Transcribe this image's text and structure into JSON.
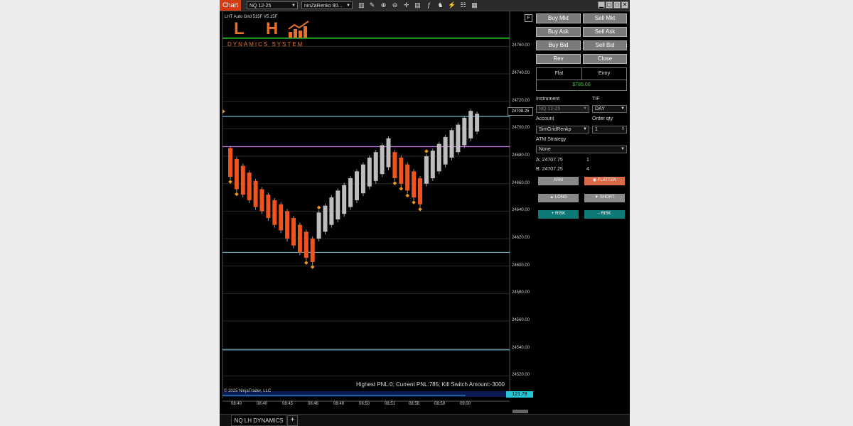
{
  "titlebar": {
    "tab_label": "Chart",
    "instrument_select": "NQ 12-25",
    "bartype_select": "ninZaRenko 80..."
  },
  "chart": {
    "indicator_label": "LHT Auto Grid 515F V5.15F",
    "logo_letters": "L H",
    "logo_subtitle": "DYNAMICS SYSTEM",
    "f_button": "F",
    "pnl_text": "Highest PNL:0; Current PNL:785; Kill Switch Amount:-3000",
    "copyright": "© 2025 NinjaTrader, LLC",
    "volume_value": "121.78",
    "current_price": "24708.25",
    "price_labels": [
      "24760.00",
      "24740.00",
      "24720.00",
      "24700.00",
      "24680.00",
      "24660.00",
      "24640.00",
      "24620.00",
      "24600.00",
      "24580.00",
      "24560.00",
      "24540.00",
      "24520.00"
    ],
    "time_labels": [
      "08:40",
      "08:40",
      "08:45",
      "08:46",
      "08:49",
      "08:50",
      "08:51",
      "08:56",
      "08:59",
      "09:00"
    ],
    "colors": {
      "up_bar": "#bdbdbd",
      "down_bar": "#f0541e",
      "green_line": "#22a822",
      "magenta_line": "#c070e0",
      "teal_line": "#6fb8c8",
      "diamond": "#e8961e"
    }
  },
  "chart_data": {
    "type": "renko",
    "ylim": [
      24513,
      24785
    ],
    "bricks": [
      {
        "dir": "down",
        "open": 24686,
        "close": 24665
      },
      {
        "dir": "down",
        "open": 24678,
        "close": 24656
      },
      {
        "dir": "down",
        "open": 24673,
        "close": 24652
      },
      {
        "dir": "down",
        "open": 24668,
        "close": 24648
      },
      {
        "dir": "down",
        "open": 24662,
        "close": 24643
      },
      {
        "dir": "down",
        "open": 24656,
        "close": 24640
      },
      {
        "dir": "down",
        "open": 24652,
        "close": 24635
      },
      {
        "dir": "down",
        "open": 24648,
        "close": 24630
      },
      {
        "dir": "down",
        "open": 24645,
        "close": 24626
      },
      {
        "dir": "down",
        "open": 24640,
        "close": 24620
      },
      {
        "dir": "down",
        "open": 24635,
        "close": 24615
      },
      {
        "dir": "down",
        "open": 24630,
        "close": 24610
      },
      {
        "dir": "down",
        "open": 24625,
        "close": 24606
      },
      {
        "dir": "down",
        "open": 24620,
        "close": 24603
      },
      {
        "dir": "up",
        "open": 24620,
        "close": 24639
      },
      {
        "dir": "up",
        "open": 24625,
        "close": 24644
      },
      {
        "dir": "up",
        "open": 24630,
        "close": 24650
      },
      {
        "dir": "up",
        "open": 24634,
        "close": 24655
      },
      {
        "dir": "up",
        "open": 24638,
        "close": 24659
      },
      {
        "dir": "up",
        "open": 24643,
        "close": 24664
      },
      {
        "dir": "up",
        "open": 24648,
        "close": 24669
      },
      {
        "dir": "up",
        "open": 24653,
        "close": 24674
      },
      {
        "dir": "up",
        "open": 24658,
        "close": 24679
      },
      {
        "dir": "up",
        "open": 24662,
        "close": 24683
      },
      {
        "dir": "up",
        "open": 24667,
        "close": 24688
      },
      {
        "dir": "up",
        "open": 24672,
        "close": 24693
      },
      {
        "dir": "down",
        "open": 24683,
        "close": 24664
      },
      {
        "dir": "down",
        "open": 24679,
        "close": 24660
      },
      {
        "dir": "down",
        "open": 24674,
        "close": 24655
      },
      {
        "dir": "down",
        "open": 24669,
        "close": 24650
      },
      {
        "dir": "down",
        "open": 24664,
        "close": 24645
      },
      {
        "dir": "up",
        "open": 24660,
        "close": 24680
      },
      {
        "dir": "up",
        "open": 24664,
        "close": 24684
      },
      {
        "dir": "up",
        "open": 24669,
        "close": 24689
      },
      {
        "dir": "up",
        "open": 24674,
        "close": 24694
      },
      {
        "dir": "up",
        "open": 24679,
        "close": 24699
      },
      {
        "dir": "up",
        "open": 24683,
        "close": 24703
      },
      {
        "dir": "up",
        "open": 24688,
        "close": 24708
      },
      {
        "dir": "up",
        "open": 24693,
        "close": 24713
      },
      {
        "dir": "up",
        "open": 24698,
        "close": 24711
      }
    ],
    "horizontal_lines": [
      {
        "price": 24766,
        "color": "green"
      },
      {
        "price": 24709,
        "color": "teal"
      },
      {
        "price": 24687,
        "color": "magenta"
      },
      {
        "price": 24610,
        "color": "teal"
      },
      {
        "price": 24539,
        "color": "teal"
      }
    ],
    "grid": true
  },
  "trade_panel": {
    "buttons": {
      "buy_mkt": "Buy Mkt",
      "sell_mkt": "Sell Mkt",
      "buy_ask": "Buy Ask",
      "sell_ask": "Sell Ask",
      "buy_bid": "Buy Bid",
      "sell_bid": "Sell Bid",
      "rev": "Rev",
      "close": "Close"
    },
    "position": "Flat",
    "entry": "Entry",
    "pnl": "$785.00",
    "instrument_label": "Instrument",
    "tif_label": "TIF",
    "instrument_value": "NQ 12-25",
    "tif_value": "DAY",
    "account_label": "Account",
    "order_qty_label": "Order qty",
    "account_value": "SimGridRenkp",
    "order_qty_value": "1",
    "atm_label": "ATM Strategy",
    "atm_value": "None",
    "ask_line": "A:  24707.75",
    "ask_qty": "1",
    "bid_line": "B:  24707.25",
    "bid_qty": "4",
    "arm": "ARM",
    "flatten": "FLATTEN",
    "long": "LONG",
    "short": "SHORT",
    "plus_risk": "+ RISK",
    "minus_risk": "- RISK"
  },
  "bottom": {
    "tab": "NQ LH DYNAMICS",
    "add": "+"
  }
}
